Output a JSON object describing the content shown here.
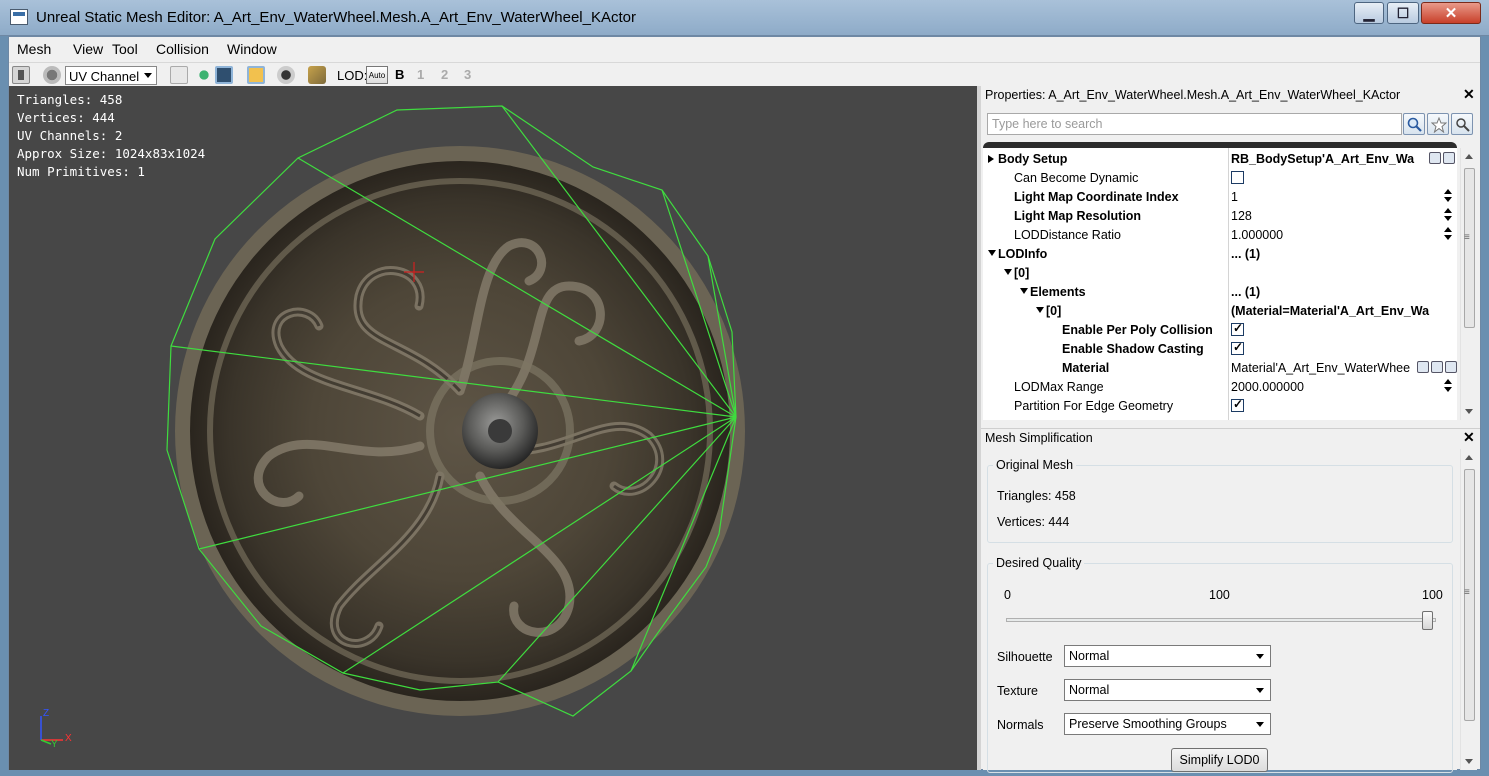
{
  "window": {
    "title": "Unreal Static Mesh Editor: A_Art_Env_WaterWheel.Mesh.A_Art_Env_WaterWheel_KActor",
    "min_glyph": "▁",
    "max_glyph": "☐",
    "close_glyph": "✕"
  },
  "menu": [
    "Mesh",
    "View",
    "Tool",
    "Collision",
    "Window"
  ],
  "toolbar": {
    "channel_select": "UV Channel",
    "lod_label": "LOD:",
    "auto_label": "Auto",
    "lod_levels": [
      "B",
      "1",
      "2",
      "3"
    ],
    "icons": [
      "move-icon",
      "uv-icon",
      "cube-icon",
      "sphere-icon",
      "wireframe-icon",
      "lock-icon",
      "eye-icon",
      "mesh-icon"
    ]
  },
  "viewport": {
    "stats": [
      "Triangles: 458",
      "Vertices: 444",
      "UV Channels: 2",
      "Approx Size: 1024x83x1024",
      "Num Primitives: 1"
    ],
    "axis": {
      "z": "Z",
      "y": "Y",
      "x": "X"
    },
    "wire_color": "#3fdc3f",
    "background": "#474747"
  },
  "properties": {
    "title": "Properties: A_Art_Env_WaterWheel.Mesh.A_Art_Env_WaterWheel_KActor",
    "close": "✕",
    "search_placeholder": "Type here to search",
    "rows": [
      {
        "name": "Body Setup",
        "value": "RB_BodySetup'A_Art_Env_Wa",
        "bold": true,
        "expander": "right",
        "indent": 0,
        "value_bold": true
      },
      {
        "name": "Can Become Dynamic",
        "value": "",
        "checkbox": false,
        "indent": 1
      },
      {
        "name": "Light Map Coordinate Index",
        "value": "1",
        "bold": true,
        "indent": 1,
        "spin": true
      },
      {
        "name": "Light Map Resolution",
        "value": "128",
        "bold": true,
        "indent": 1,
        "spin": true
      },
      {
        "name": "LODDistance Ratio",
        "value": "1.000000",
        "indent": 1,
        "spin": true
      },
      {
        "name": "LODInfo",
        "value": "... (1)",
        "bold": true,
        "expander": "down",
        "indent": 0,
        "value_bold": true
      },
      {
        "name": "[0]",
        "value": "",
        "bold": true,
        "expander": "down",
        "indent": 1
      },
      {
        "name": "Elements",
        "value": "... (1)",
        "bold": true,
        "expander": "down",
        "indent": 2,
        "value_bold": true
      },
      {
        "name": "[0]",
        "value": "(Material=Material'A_Art_Env_Wa",
        "bold": true,
        "expander": "down",
        "indent": 3,
        "value_bold": true
      },
      {
        "name": "Enable Per Poly Collision",
        "value": "",
        "bold": true,
        "checkbox": true,
        "indent": 4
      },
      {
        "name": "Enable Shadow Casting",
        "value": "",
        "bold": true,
        "checkbox": true,
        "indent": 4
      },
      {
        "name": "Material",
        "value": "Material'A_Art_Env_WaterWhee",
        "bold": true,
        "indent": 4,
        "material": true
      },
      {
        "name": "LODMax Range",
        "value": "2000.000000",
        "indent": 1,
        "spin": true
      },
      {
        "name": "Partition For Edge Geometry",
        "value": "",
        "checkbox": true,
        "indent": 1
      }
    ]
  },
  "simplification": {
    "title": "Mesh Simplification",
    "close": "✕",
    "original_label": "Original Mesh",
    "triangles": "Triangles: 458",
    "vertices": "Vertices: 444",
    "quality_label": "Desired Quality",
    "scale_min": "0",
    "scale_mid": "100",
    "scale_max": "100",
    "quality_value": 100,
    "silhouette_label": "Silhouette",
    "silhouette_value": "Normal",
    "texture_label": "Texture",
    "texture_value": "Normal",
    "normals_label": "Normals",
    "normals_value": "Preserve Smoothing Groups",
    "simplify_button": "Simplify LOD0"
  }
}
